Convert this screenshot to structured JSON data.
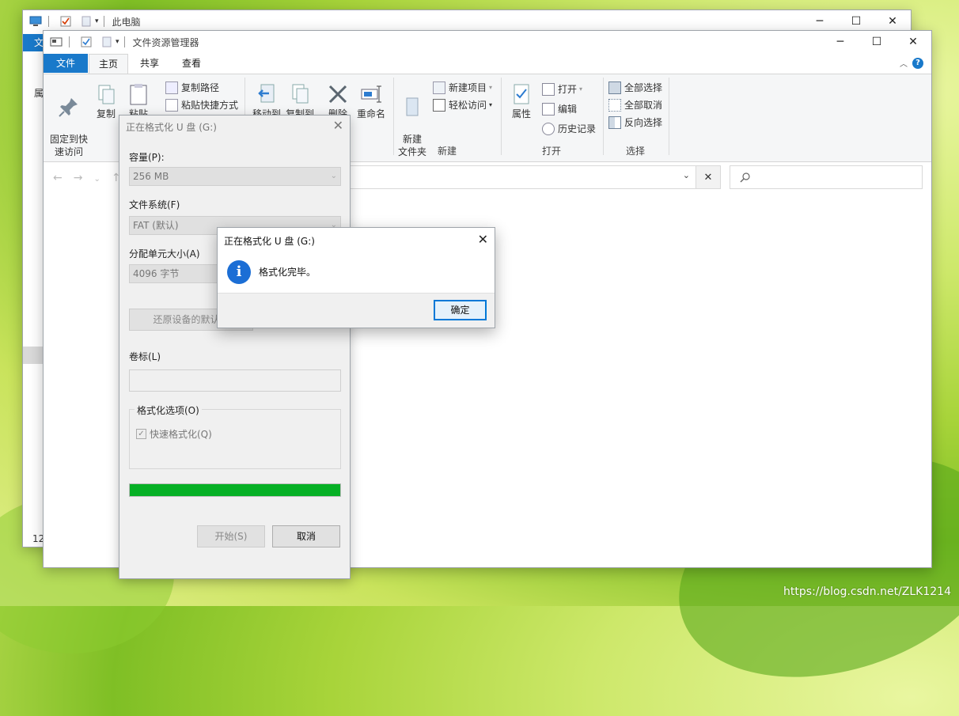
{
  "back_window": {
    "title": "此电脑",
    "file_tab": "文",
    "left_text_1": "属",
    "status_count": "12"
  },
  "explorer": {
    "title": "文件资源管理器",
    "tabs": [
      {
        "label": "文件"
      },
      {
        "label": "主页"
      },
      {
        "label": "共享"
      },
      {
        "label": "查看"
      }
    ],
    "clipboard": {
      "pin_label": "固定到快\n速访问",
      "copy_label": "复制",
      "paste_label": "粘贴",
      "copy_path": "复制路径",
      "paste_shortcut": "粘贴快捷方式"
    },
    "organize": {
      "move_to": "移动到",
      "copy_to": "复制到",
      "delete": "删除",
      "rename": "重命名"
    },
    "new_group": {
      "new_folder": "新建\n文件夹",
      "new_item": "新建项目",
      "easy_access": "轻松访问",
      "group_label": "新建"
    },
    "open_group": {
      "properties": "属性",
      "open": "打开",
      "edit": "编辑",
      "history": "历史记录",
      "group_label": "打开"
    },
    "select_group": {
      "select_all": "全部选择",
      "select_none": "全部取消",
      "invert": "反向选择",
      "group_label": "选择"
    }
  },
  "format_dialog": {
    "title": "正在格式化 U 盘 (G:)",
    "capacity_label": "容量(P):",
    "capacity_value": "256 MB",
    "fs_label": "文件系统(F)",
    "fs_value": "FAT (默认)",
    "alloc_label": "分配单元大小(A)",
    "alloc_value": "4096 字节",
    "restore_button": "还原设备的默认值",
    "volume_label": "卷标(L)",
    "volume_value": "",
    "options_label": "格式化选项(O)",
    "quick_format": "快速格式化(Q)",
    "progress": 1.0,
    "start_button": "开始(S)",
    "cancel_button": "取消"
  },
  "message_box": {
    "title": "正在格式化 U 盘 (G:)",
    "message": "格式化完毕。",
    "ok_button": "确定"
  },
  "watermark": "https://blog.csdn.net/ZLK1214",
  "colors": {
    "accent": "#1979ca",
    "progress": "#06b025",
    "info_icon": "#1b6ed5",
    "ok_border": "#0078d7"
  }
}
